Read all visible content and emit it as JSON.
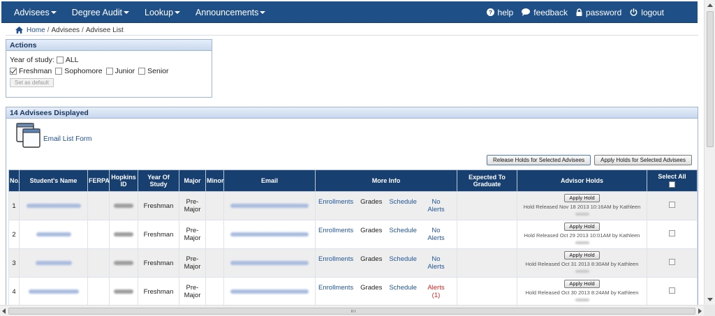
{
  "nav": {
    "menus": [
      "Advisees",
      "Degree Audit",
      "Lookup",
      "Announcements"
    ],
    "links": [
      {
        "icon": "help-icon",
        "label": "help"
      },
      {
        "icon": "feedback-icon",
        "label": "feedback"
      },
      {
        "icon": "lock-icon",
        "label": "password"
      },
      {
        "icon": "power-icon",
        "label": "logout"
      }
    ],
    "bg_color": "#1e4f86"
  },
  "breadcrumb": {
    "items": [
      "Home",
      "Advisees",
      "Advisee List"
    ],
    "separator": "/"
  },
  "actions": {
    "title": "Actions",
    "year_label": "Year of study:",
    "all_label": "ALL",
    "all_checked": false,
    "years": [
      {
        "label": "Freshman",
        "checked": true
      },
      {
        "label": "Sophomore",
        "checked": false
      },
      {
        "label": "Junior",
        "checked": false
      },
      {
        "label": "Senior",
        "checked": false
      }
    ],
    "default_button": "Set as default"
  },
  "advisees": {
    "title": "14 Advisees Displayed",
    "email_list_label": "Email List Form",
    "release_button": "Release Holds for Selected Advisees",
    "apply_button": "Apply Holds for Selected Advisees",
    "columns": {
      "no": "No.",
      "name": "Student's Name",
      "ferpa": "FERPA",
      "hopkins_id": "Hopkins ID",
      "year": "Year Of Study",
      "major": "Major",
      "minor": "Minor",
      "email": "Email",
      "more_info": "More Info",
      "expected": "Expected To Graduate",
      "holds": "Advisor Holds",
      "select_all": "Select All"
    },
    "more_info_links": {
      "enrollments": "Enrollments",
      "grades": "Grades",
      "schedule": "Schedule"
    },
    "apply_hold_label": "Apply Hold",
    "rows": [
      {
        "no": "1",
        "year": "Freshman",
        "major": "Pre-Major",
        "alerts": "No Alerts",
        "has_alerts": false,
        "hold_text": "Hold Released Nov 18 2013 10:16AM by Kathleen"
      },
      {
        "no": "2",
        "year": "Freshman",
        "major": "Pre-Major",
        "alerts": "No Alerts",
        "has_alerts": false,
        "hold_text": "Hold Released Oct 29 2013 10:01AM by Kathleen"
      },
      {
        "no": "3",
        "year": "Freshman",
        "major": "Pre-Major",
        "alerts": "No Alerts",
        "has_alerts": false,
        "hold_text": "Hold Released Oct 31 2013 8:30AM by Kathleen"
      },
      {
        "no": "4",
        "year": "Freshman",
        "major": "Pre-Major",
        "alerts": "Alerts (1)",
        "has_alerts": true,
        "hold_text": "Hold Released Oct 30 2013 8:24AM by Kathleen"
      }
    ]
  }
}
